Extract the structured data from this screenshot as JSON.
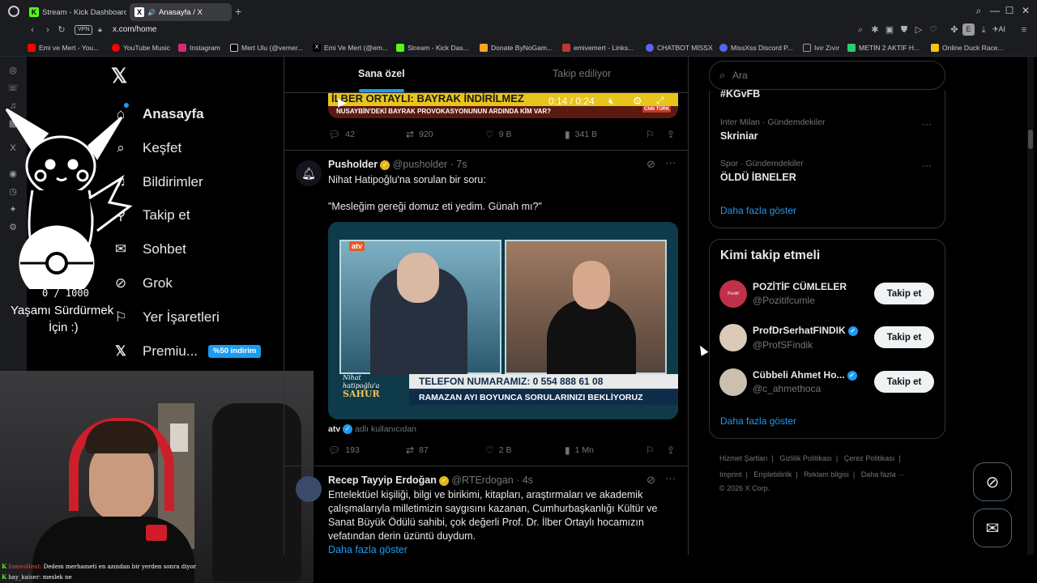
{
  "browser": {
    "tabs": [
      {
        "label": "Stream - Kick Dashboard",
        "fav": "K",
        "fav_color": "#53fc18"
      },
      {
        "label": "Anasayfa / X",
        "fav": "X",
        "fav_color": "#ffffff"
      }
    ],
    "url": "x.com/home",
    "vpn_label": "VPN",
    "profile_letter": "E",
    "ai_label": "AI",
    "bookmarks": [
      {
        "label": "Emi ve Mert - You...",
        "color": "#ff0000"
      },
      {
        "label": "YouTube Music",
        "color": "#ff0000"
      },
      {
        "label": "Instagram",
        "color": "#d62976"
      },
      {
        "label": "Mert Ulu (@vemer...",
        "color": "#ffffff"
      },
      {
        "label": "Emi Ve Mert (@em...",
        "color": "#ffffff"
      },
      {
        "label": "Stream - Kick Das...",
        "color": "#53fc18"
      },
      {
        "label": "Donate ByNoGam...",
        "color": "#f5a623"
      },
      {
        "label": "emivemert - Links...",
        "color": "#c0392b"
      },
      {
        "label": "CHATBOT MİSSX",
        "color": "#5865f2"
      },
      {
        "label": "MissXss Discord P...",
        "color": "#5865f2"
      },
      {
        "label": "Ivır Zıvır",
        "color": "#9a9ca2"
      },
      {
        "label": "METİN 2 AKTİF H...",
        "color": "#2ecc71"
      },
      {
        "label": "Online Duck Race...",
        "color": "#f1c40f"
      }
    ]
  },
  "overlay": {
    "counter": "0 / 1000",
    "caption_line1": "Yaşamı Sürdürmek",
    "caption_line2": "İçin :)"
  },
  "nav": {
    "items": [
      {
        "label": "Anasayfa",
        "icon": "home-icon"
      },
      {
        "label": "Keşfet",
        "icon": "search-icon"
      },
      {
        "label": "Bildirimler",
        "icon": "bell-icon"
      },
      {
        "label": "Takip et",
        "icon": "add-user-icon"
      },
      {
        "label": "Sohbet",
        "icon": "mail-icon"
      },
      {
        "label": "Grok",
        "icon": "grok-icon"
      },
      {
        "label": "Yer İşaretleri",
        "icon": "bookmark-icon"
      },
      {
        "label": "Premiu...",
        "icon": "x-logo-icon"
      }
    ],
    "premium_badge": "%50 indirim"
  },
  "timeline": {
    "tabs": [
      "Sana özel",
      "Takip ediliyor"
    ],
    "video_post": {
      "headline": "İLBER ORTAYLI: BAYRAK İNDİRİLMEZ",
      "subline": "NUSAYBİN'DEKİ BAYRAK PROVOKASYONUNUN ARDINDA KİM VAR?",
      "time": "0:14 / 0:24",
      "channel": "CNN TÜRK",
      "replies": "42",
      "reposts": "920",
      "likes": "9 B",
      "views": "341 B"
    },
    "post1": {
      "name": "Pusholder",
      "handle": "@pusholder",
      "time": "· 7s",
      "line1": "Nihat Hatipoğlu'na sorulan bir soru:",
      "line2": "\"Mesleğim gereği domuz eti yedim. Günah mı?\"",
      "media_channel": "atv",
      "media_phone": "TELEFON NUMARAMIZ: 0 554 888 61 08",
      "media_banner": "RAMAZAN AYI BOYUNCA SORULARINIZI BEKLİYORUZ",
      "media_show_line1": "Nihat",
      "media_show_line2": "hatipoğlu'a",
      "media_show_line3": "SAHUR",
      "source_name": "atv",
      "source_suffix": "adlı kullanıcıdan",
      "replies": "193",
      "reposts": "87",
      "likes": "2 B",
      "views": "1 Mn"
    },
    "post2": {
      "name": "Recep Tayyip Erdoğan",
      "handle": "@RTErdogan",
      "time": "· 4s",
      "text1": "Entelektüel kişiliği, bilgi ve birikimi, kitapları, araştırmaları ve akademik",
      "text2": "çalışmalarıyla milletimizin saygısını kazanan, Cumhurbaşkanlığı Kültür ve",
      "text3": "Sanat Büyük Ödülü sahibi, çok değerli Prof. Dr. İlber Ortaylı hocamızın",
      "text4": "vefatından derin üzüntü duydum.",
      "show_more": "Daha fazla göster"
    }
  },
  "sidebar": {
    "search_placeholder": "Ara",
    "trends": [
      {
        "category": "",
        "name": "#KGvFB"
      },
      {
        "category": "Inter Milan · Gündemdekiler",
        "name": "Skriniar"
      },
      {
        "category": "Spor · Gündemdekiler",
        "name": "ÖLDÜ İBNELER"
      }
    ],
    "trends_more": "Daha fazla göster",
    "who_to_follow_title": "Kimi takip etmeli",
    "suggestions": [
      {
        "name": "POZİTİF CÜMLELER",
        "handle": "@Pozitifcumle",
        "verified": false,
        "avatar_text": "Pozitif CÜMLELER",
        "avatar_color": "#c0304a"
      },
      {
        "name": "ProfDrSerhatFINDIK",
        "handle": "@ProfSFindik",
        "verified": true,
        "avatar_text": "",
        "avatar_color": "#d9cbb8"
      },
      {
        "name": "Cübbeli Ahmet Ho...",
        "handle": "@c_ahmethoca",
        "verified": true,
        "avatar_text": "",
        "avatar_color": "#cbbfae"
      }
    ],
    "follow_label": "Takip et",
    "follow_more": "Daha fazla göster",
    "footer": {
      "links_row1": [
        "Hizmet Şartları",
        "|",
        "Gizlilik Politikası",
        "|",
        "Çerez Politikası",
        "|"
      ],
      "links_row2": [
        "Imprint",
        "|",
        "Erişilebilirlik",
        "|",
        "Reklam bilgisi",
        "|",
        "Daha fazla ···"
      ],
      "copyright": "© 2026 X Corp."
    }
  },
  "chat": {
    "lines": [
      {
        "user": "fumesHeat:",
        "text": "Dedem merhameti en azından bir yerden sonra diyor",
        "color": "#e74c3c"
      },
      {
        "user": "bay_kaiser:",
        "text": "meslek ne",
        "color": "#e7e9ea"
      }
    ]
  },
  "colors": {
    "accent": "#1d9bf0",
    "background": "#000000",
    "premium_badge": "#1d9bf0"
  }
}
